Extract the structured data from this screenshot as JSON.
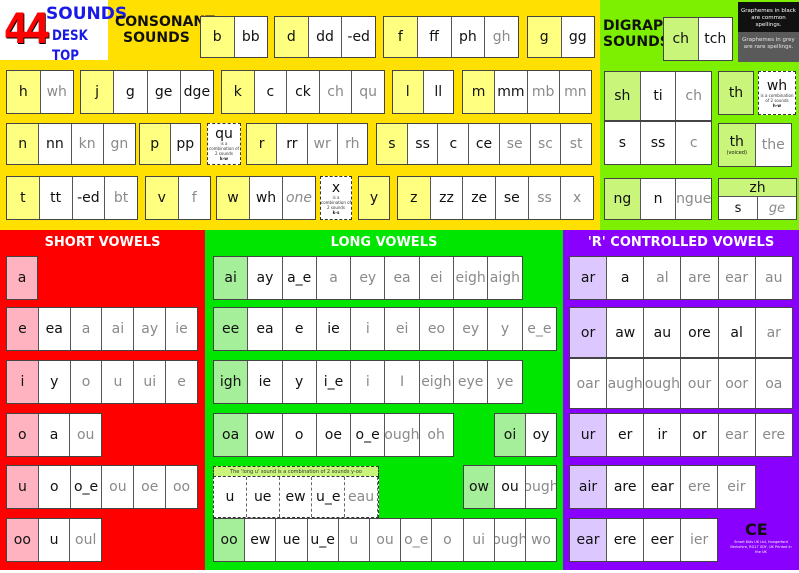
{
  "logo": {
    "number": "44",
    "line1": "SOUNDS",
    "line2": "DESK TOP"
  },
  "consonants": {
    "heading_line1": "CONSONANT",
    "heading_line2": "SOUNDS",
    "groups": [
      {
        "cells": [
          {
            "t": "b",
            "key": true
          },
          {
            "t": "bb"
          }
        ]
      },
      {
        "cells": [
          {
            "t": "d",
            "key": true
          },
          {
            "t": "dd"
          },
          {
            "t": "-ed"
          }
        ]
      },
      {
        "cells": [
          {
            "t": "f",
            "key": true
          },
          {
            "t": "ff"
          },
          {
            "t": "ph"
          },
          {
            "t": "gh",
            "rare": true
          }
        ]
      },
      {
        "cells": [
          {
            "t": "g",
            "key": true
          },
          {
            "t": "gg"
          }
        ]
      },
      {
        "cells": [
          {
            "t": "h",
            "key": true
          },
          {
            "t": "wh",
            "rare": true
          }
        ]
      },
      {
        "cells": [
          {
            "t": "j",
            "key": true
          },
          {
            "t": "g"
          },
          {
            "t": "ge"
          },
          {
            "t": "dge"
          }
        ]
      },
      {
        "cells": [
          {
            "t": "k",
            "key": true
          },
          {
            "t": "c"
          },
          {
            "t": "ck"
          },
          {
            "t": "ch",
            "rare": true
          },
          {
            "t": "qu",
            "rare": true
          }
        ]
      },
      {
        "cells": [
          {
            "t": "l",
            "key": true
          },
          {
            "t": "ll"
          }
        ]
      },
      {
        "cells": [
          {
            "t": "m",
            "key": true
          },
          {
            "t": "mm"
          },
          {
            "t": "mb",
            "rare": true
          },
          {
            "t": "mn",
            "rare": true
          }
        ]
      },
      {
        "cells": [
          {
            "t": "n",
            "key": true
          },
          {
            "t": "nn"
          },
          {
            "t": "kn",
            "rare": true
          },
          {
            "t": "gn",
            "rare": true
          }
        ]
      },
      {
        "cells": [
          {
            "t": "p",
            "key": true
          },
          {
            "t": "pp"
          }
        ]
      },
      {
        "cells": [
          {
            "t": "r",
            "key": true
          },
          {
            "t": "rr"
          },
          {
            "t": "wr",
            "rare": true
          },
          {
            "t": "rh",
            "rare": true
          }
        ]
      },
      {
        "cells": [
          {
            "t": "s",
            "key": true
          },
          {
            "t": "ss"
          },
          {
            "t": "c"
          },
          {
            "t": "ce"
          },
          {
            "t": "se",
            "rare": true
          },
          {
            "t": "sc",
            "rare": true
          },
          {
            "t": "st",
            "rare": true
          }
        ]
      },
      {
        "cells": [
          {
            "t": "t",
            "key": true
          },
          {
            "t": "tt"
          },
          {
            "t": "-ed"
          },
          {
            "t": "bt",
            "rare": true
          }
        ]
      },
      {
        "cells": [
          {
            "t": "v",
            "key": true
          },
          {
            "t": "f",
            "rare": true
          }
        ]
      },
      {
        "cells": [
          {
            "t": "w",
            "key": true
          },
          {
            "t": "wh"
          },
          {
            "t": "one",
            "rare": true,
            "italic": true
          }
        ]
      },
      {
        "cells": [
          {
            "t": "y",
            "key": true
          }
        ]
      },
      {
        "cells": [
          {
            "t": "z",
            "key": true
          },
          {
            "t": "zz"
          },
          {
            "t": "ze"
          },
          {
            "t": "se"
          },
          {
            "t": "ss",
            "rare": true
          },
          {
            "t": "x",
            "rare": true
          }
        ]
      }
    ],
    "combos": {
      "qu": {
        "big": "qu",
        "text": "is a combination of 2 sounds",
        "sounds": "k-w"
      },
      "x": {
        "big": "x",
        "text": "is a combination of 2 sounds",
        "sounds": "k-s"
      }
    }
  },
  "digraphs": {
    "heading_line1": "DIGRAPH",
    "heading_line2": "SOUNDS",
    "legend_black": "Graphemes in black are common spellings.",
    "legend_grey": "Graphemes in grey are rare spellings.",
    "groups": [
      {
        "cells": [
          {
            "t": "ch",
            "key": true
          },
          {
            "t": "tch"
          }
        ]
      },
      {
        "cells": [
          {
            "t": "sh",
            "key": true
          },
          {
            "t": "ti"
          },
          {
            "t": "ch",
            "rare": true
          }
        ]
      },
      {
        "cells": [
          {
            "t": "s"
          },
          {
            "t": "ss"
          },
          {
            "t": "c",
            "rare": true
          }
        ]
      },
      {
        "cells": [
          {
            "t": "th",
            "key": true
          }
        ]
      },
      {
        "cells": [
          {
            "t": "th",
            "key": true,
            "note": "(voiced)"
          },
          {
            "t": "the",
            "rare": true
          }
        ]
      },
      {
        "cells": [
          {
            "t": "ng",
            "key": true
          },
          {
            "t": "n"
          },
          {
            "t": "ngue",
            "rare": true
          }
        ]
      }
    ],
    "wh_combo": {
      "big": "wh",
      "text": "is a combination of 2 sounds",
      "sounds": "h-w"
    },
    "zh": {
      "head": "zh",
      "cells": [
        {
          "t": "s"
        },
        {
          "t": "ge",
          "rare": true
        }
      ]
    }
  },
  "short_vowels": {
    "title": "SHORT VOWELS",
    "rows": [
      [
        {
          "t": "a",
          "key": true
        }
      ],
      [
        {
          "t": "e",
          "key": true
        },
        {
          "t": "ea"
        },
        {
          "t": "a",
          "rare": true
        },
        {
          "t": "ai",
          "rare": true
        },
        {
          "t": "ay",
          "rare": true
        },
        {
          "t": "ie",
          "rare": true
        }
      ],
      [
        {
          "t": "i",
          "key": true
        },
        {
          "t": "y"
        },
        {
          "t": "o",
          "rare": true
        },
        {
          "t": "u",
          "rare": true
        },
        {
          "t": "ui",
          "rare": true
        },
        {
          "t": "e",
          "rare": true
        }
      ],
      [
        {
          "t": "o",
          "key": true
        },
        {
          "t": "a"
        },
        {
          "t": "ou",
          "rare": true
        }
      ],
      [
        {
          "t": "u",
          "key": true
        },
        {
          "t": "o"
        },
        {
          "t": "o_e"
        },
        {
          "t": "ou",
          "rare": true
        },
        {
          "t": "oe",
          "rare": true
        },
        {
          "t": "oo",
          "rare": true
        }
      ],
      [
        {
          "t": "oo",
          "key": true
        },
        {
          "t": "u"
        },
        {
          "t": "oul",
          "rare": true
        }
      ]
    ]
  },
  "long_vowels": {
    "title": "LONG VOWELS",
    "rows": [
      [
        {
          "t": "ai",
          "key": true
        },
        {
          "t": "ay"
        },
        {
          "t": "a_e"
        },
        {
          "t": "a",
          "rare": true
        },
        {
          "t": "ey",
          "rare": true
        },
        {
          "t": "ea",
          "rare": true
        },
        {
          "t": "ei",
          "rare": true
        },
        {
          "t": "eigh",
          "rare": true
        },
        {
          "t": "aigh",
          "rare": true
        }
      ],
      [
        {
          "t": "ee",
          "key": true
        },
        {
          "t": "ea"
        },
        {
          "t": "e"
        },
        {
          "t": "ie"
        },
        {
          "t": "i",
          "rare": true
        },
        {
          "t": "ei",
          "rare": true
        },
        {
          "t": "eo",
          "rare": true
        },
        {
          "t": "ey",
          "rare": true
        },
        {
          "t": "y",
          "rare": true
        },
        {
          "t": "e_e",
          "rare": true
        }
      ],
      [
        {
          "t": "igh",
          "key": true
        },
        {
          "t": "ie"
        },
        {
          "t": "y"
        },
        {
          "t": "i_e"
        },
        {
          "t": "i",
          "rare": true
        },
        {
          "t": "I",
          "rare": true
        },
        {
          "t": "eigh",
          "rare": true
        },
        {
          "t": "eye",
          "rare": true
        },
        {
          "t": "ye",
          "rare": true
        }
      ],
      [
        {
          "t": "oa",
          "key": true
        },
        {
          "t": "ow"
        },
        {
          "t": "o"
        },
        {
          "t": "oe"
        },
        {
          "t": "o_e"
        },
        {
          "t": "ough",
          "rare": true
        },
        {
          "t": "oh",
          "rare": true
        }
      ]
    ],
    "oi": [
      {
        "t": "oi",
        "key": true
      },
      {
        "t": "oy"
      }
    ],
    "long_u_header": "The 'long u' sound is a combination of 2 sounds y-oo",
    "long_u": [
      {
        "t": "u"
      },
      {
        "t": "ue"
      },
      {
        "t": "ew"
      },
      {
        "t": "u_e"
      },
      {
        "t": "eau",
        "rare": true
      }
    ],
    "ow": [
      {
        "t": "ow",
        "key": true
      },
      {
        "t": "ou"
      },
      {
        "t": "ough",
        "rare": true
      }
    ],
    "oo": [
      {
        "t": "oo",
        "key": true
      },
      {
        "t": "ew"
      },
      {
        "t": "ue"
      },
      {
        "t": "u_e"
      },
      {
        "t": "u",
        "rare": true
      },
      {
        "t": "ou",
        "rare": true
      },
      {
        "t": "o_e",
        "rare": true
      },
      {
        "t": "o",
        "rare": true
      },
      {
        "t": "ui",
        "rare": true
      },
      {
        "t": "ough",
        "rare": true
      },
      {
        "t": "wo",
        "rare": true
      }
    ]
  },
  "r_controlled": {
    "title": "'R' CONTROLLED VOWELS",
    "rows": [
      [
        {
          "t": "ar",
          "key": true
        },
        {
          "t": "a"
        },
        {
          "t": "al",
          "rare": true
        },
        {
          "t": "are",
          "rare": true
        },
        {
          "t": "ear",
          "rare": true
        },
        {
          "t": "au",
          "rare": true
        }
      ],
      [
        {
          "t": "or",
          "key": true
        },
        {
          "t": "aw"
        },
        {
          "t": "au"
        },
        {
          "t": "ore"
        },
        {
          "t": "al"
        },
        {
          "t": "ar",
          "rare": true
        }
      ],
      [
        {
          "t": "oar",
          "rare": true
        },
        {
          "t": "augh",
          "rare": true
        },
        {
          "t": "ough",
          "rare": true
        },
        {
          "t": "our",
          "rare": true
        },
        {
          "t": "oor",
          "rare": true
        },
        {
          "t": "oa",
          "rare": true
        }
      ],
      [
        {
          "t": "ur",
          "key": true
        },
        {
          "t": "er"
        },
        {
          "t": "ir"
        },
        {
          "t": "or"
        },
        {
          "t": "ear",
          "rare": true
        },
        {
          "t": "ere",
          "rare": true
        }
      ],
      [
        {
          "t": "air",
          "key": true
        },
        {
          "t": "are"
        },
        {
          "t": "ear"
        },
        {
          "t": "ere",
          "rare": true
        },
        {
          "t": "eir",
          "rare": true
        }
      ],
      [
        {
          "t": "ear",
          "key": true
        },
        {
          "t": "ere"
        },
        {
          "t": "eer"
        },
        {
          "t": "ier",
          "rare": true
        }
      ]
    ]
  },
  "footer": {
    "ce_mark": "CE",
    "address": "Smart Kids UK Ltd, Hungerford Berkshire, RG17 0DY, UK Printed in the UK"
  }
}
